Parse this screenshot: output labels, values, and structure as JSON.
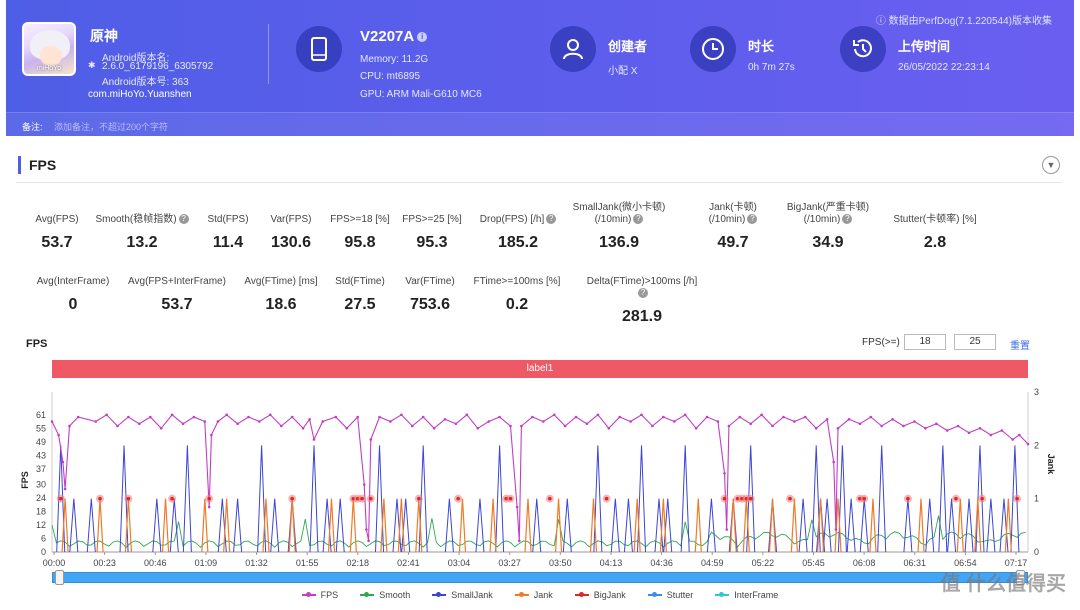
{
  "header": {
    "collected_note": "数据由PerfDog(7.1.220544)版本收集",
    "app": {
      "name": "原神",
      "icon_logo_text": "miHoYo",
      "version_label": "Android版本名:",
      "version_name": "2.6.0_6179196_6305792",
      "version_code": "Android版本号: 363",
      "package": "com.miHoYo.Yuanshen"
    },
    "device": {
      "name": "V2207A",
      "memory": "Memory: 11.2G",
      "cpu": "CPU: mt6895",
      "gpu": "GPU: ARM Mali-G610 MC6"
    },
    "creator": {
      "label": "创建者",
      "value": "小配 X"
    },
    "duration": {
      "label": "时长",
      "value": "0h 7m 27s"
    },
    "upload": {
      "label": "上传时间",
      "value": "26/05/2022 22:23:14"
    },
    "remark": {
      "label": "备注:",
      "placeholder": "添加备注，不超过200个字符"
    }
  },
  "section": {
    "title": "FPS"
  },
  "stats_row1": [
    {
      "label": "Avg(FPS)",
      "value": "53.7"
    },
    {
      "label": "Smooth(稳帧指数)",
      "value": "13.2",
      "help": true
    },
    {
      "label": "Std(FPS)",
      "value": "11.4"
    },
    {
      "label": "Var(FPS)",
      "value": "130.6"
    },
    {
      "label": "FPS>=18 [%]",
      "value": "95.8"
    },
    {
      "label": "FPS>=25 [%]",
      "value": "95.3"
    },
    {
      "label": "Drop(FPS) [/h]",
      "value": "185.2",
      "help": true
    },
    {
      "label": "SmallJank(微小卡顿)",
      "label2": "(/10min)",
      "value": "136.9",
      "help": true
    },
    {
      "label": "Jank(卡顿)",
      "label2": "(/10min)",
      "value": "49.7",
      "help": true
    },
    {
      "label": "BigJank(严重卡顿)",
      "label2": "(/10min)",
      "value": "34.9",
      "help": true
    },
    {
      "label": "Stutter(卡顿率) [%]",
      "value": "2.8"
    }
  ],
  "stats_row2": [
    {
      "label": "Avg(InterFrame)",
      "value": "0"
    },
    {
      "label": "Avg(FPS+InterFrame)",
      "value": "53.7"
    },
    {
      "label": "Avg(FTime) [ms]",
      "value": "18.6"
    },
    {
      "label": "Std(FTime)",
      "value": "27.5"
    },
    {
      "label": "Var(FTime)",
      "value": "753.6"
    },
    {
      "label": "FTime>=100ms [%]",
      "value": "0.2"
    },
    {
      "label": "Delta(FTime)>100ms [/h]",
      "value": "281.9",
      "help": true
    }
  ],
  "chart_controls": {
    "title": "FPS",
    "threshold_label": "FPS(>=)",
    "threshold1": "18",
    "threshold2": "25",
    "reset": "重置",
    "label_bar": "label1"
  },
  "chart_data": {
    "type": "line",
    "y_left_label": "FPS",
    "y_right_label": "Jank",
    "y_left_ticks": [
      "0",
      "6",
      "12",
      "18",
      "24",
      "30",
      "37",
      "43",
      "49",
      "55",
      "61"
    ],
    "y_left_range": [
      0,
      64
    ],
    "y_right_ticks": [
      "0",
      "1",
      "2",
      "3"
    ],
    "y_right_range": [
      0,
      3
    ],
    "x_ticks": [
      "00:00",
      "00:23",
      "00:46",
      "01:09",
      "01:32",
      "01:55",
      "02:18",
      "02:41",
      "03:04",
      "03:27",
      "03:50",
      "04:13",
      "04:36",
      "04:59",
      "05:22",
      "05:45",
      "06:08",
      "06:31",
      "06:54",
      "07:17"
    ],
    "x_range_seconds": [
      0,
      447
    ],
    "series": [
      {
        "name": "FPS",
        "color": "#c13ec4",
        "segments": [
          [
            0,
            58
          ],
          [
            3,
            52
          ],
          [
            5,
            40
          ],
          [
            6,
            28
          ],
          [
            8,
            56
          ],
          [
            12,
            60
          ],
          [
            20,
            58
          ],
          [
            25,
            61
          ],
          [
            30,
            56
          ],
          [
            35,
            60
          ],
          [
            40,
            57
          ],
          [
            45,
            60
          ],
          [
            50,
            55
          ],
          [
            55,
            61
          ],
          [
            60,
            57
          ],
          [
            65,
            60
          ],
          [
            70,
            58
          ],
          [
            72,
            20
          ],
          [
            73,
            52
          ],
          [
            76,
            58
          ],
          [
            80,
            61
          ],
          [
            85,
            57
          ],
          [
            90,
            60
          ],
          [
            95,
            58
          ],
          [
            100,
            61
          ],
          [
            105,
            56
          ],
          [
            110,
            60
          ],
          [
            115,
            55
          ],
          [
            118,
            59
          ],
          [
            120,
            50
          ],
          [
            124,
            58
          ],
          [
            130,
            60
          ],
          [
            135,
            55
          ],
          [
            140,
            60
          ],
          [
            143,
            30
          ],
          [
            144,
            10
          ],
          [
            145,
            5
          ],
          [
            146,
            50
          ],
          [
            150,
            60
          ],
          [
            155,
            58
          ],
          [
            160,
            61
          ],
          [
            165,
            56
          ],
          [
            170,
            60
          ],
          [
            175,
            55
          ],
          [
            180,
            59
          ],
          [
            185,
            57
          ],
          [
            190,
            61
          ],
          [
            195,
            55
          ],
          [
            200,
            58
          ],
          [
            205,
            60
          ],
          [
            210,
            56
          ],
          [
            213,
            20
          ],
          [
            214,
            5
          ],
          [
            215,
            56
          ],
          [
            220,
            60
          ],
          [
            225,
            58
          ],
          [
            230,
            61
          ],
          [
            235,
            56
          ],
          [
            240,
            60
          ],
          [
            245,
            57
          ],
          [
            250,
            61
          ],
          [
            255,
            55
          ],
          [
            260,
            60
          ],
          [
            265,
            58
          ],
          [
            270,
            61
          ],
          [
            275,
            56
          ],
          [
            280,
            60
          ],
          [
            285,
            58
          ],
          [
            290,
            61
          ],
          [
            295,
            55
          ],
          [
            300,
            60
          ],
          [
            305,
            58
          ],
          [
            308,
            35
          ],
          [
            309,
            10
          ],
          [
            310,
            56
          ],
          [
            315,
            60
          ],
          [
            320,
            57
          ],
          [
            325,
            61
          ],
          [
            330,
            56
          ],
          [
            335,
            60
          ],
          [
            340,
            58
          ],
          [
            345,
            60
          ],
          [
            350,
            55
          ],
          [
            355,
            59
          ],
          [
            358,
            40
          ],
          [
            359,
            10
          ],
          [
            360,
            55
          ],
          [
            365,
            59
          ],
          [
            370,
            57
          ],
          [
            375,
            60
          ],
          [
            380,
            56
          ],
          [
            385,
            59
          ],
          [
            390,
            56
          ],
          [
            395,
            58
          ],
          [
            400,
            55
          ],
          [
            405,
            57
          ],
          [
            410,
            54
          ],
          [
            415,
            56
          ],
          [
            420,
            53
          ],
          [
            425,
            55
          ],
          [
            430,
            52
          ],
          [
            435,
            54
          ],
          [
            440,
            50
          ],
          [
            443,
            52
          ],
          [
            447,
            48
          ]
        ]
      },
      {
        "name": "Smooth",
        "color": "#2fa84f"
      },
      {
        "name": "SmallJank",
        "color": "#3b45d6"
      },
      {
        "name": "Jank",
        "color": "#f07a28"
      },
      {
        "name": "BigJank",
        "color": "#e02727"
      },
      {
        "name": "Stutter",
        "color": "#3c8de8"
      },
      {
        "name": "InterFrame",
        "color": "#2cc9c9"
      }
    ],
    "smalljank_times": [
      4,
      10,
      18,
      33,
      48,
      56,
      62,
      78,
      85,
      96,
      102,
      110,
      120,
      126,
      132,
      150,
      158,
      162,
      170,
      182,
      196,
      205,
      222,
      236,
      250,
      258,
      264,
      270,
      278,
      282,
      290,
      302,
      312,
      320,
      330,
      344,
      350,
      352,
      355,
      362,
      366,
      372,
      380,
      392,
      402,
      408,
      412,
      420,
      425,
      430,
      436,
      441
    ],
    "jank_times": [
      6,
      22,
      35,
      52,
      70,
      80,
      98,
      110,
      128,
      138,
      152,
      160,
      168,
      188,
      202,
      218,
      232,
      248,
      268,
      280,
      296,
      312,
      318,
      330,
      340,
      352,
      360,
      376,
      398,
      416,
      424,
      438
    ],
    "bigjank_markers_times": [
      4,
      22,
      35,
      55,
      72,
      110,
      138,
      140,
      142,
      146,
      168,
      186,
      208,
      210,
      228,
      254,
      308,
      314,
      316,
      318,
      320,
      338,
      370,
      372,
      392,
      414,
      426,
      442
    ]
  },
  "legend": [
    "FPS",
    "Smooth",
    "SmallJank",
    "Jank",
    "BigJank",
    "Stutter",
    "InterFrame"
  ],
  "watermark": "值 什么值得买"
}
